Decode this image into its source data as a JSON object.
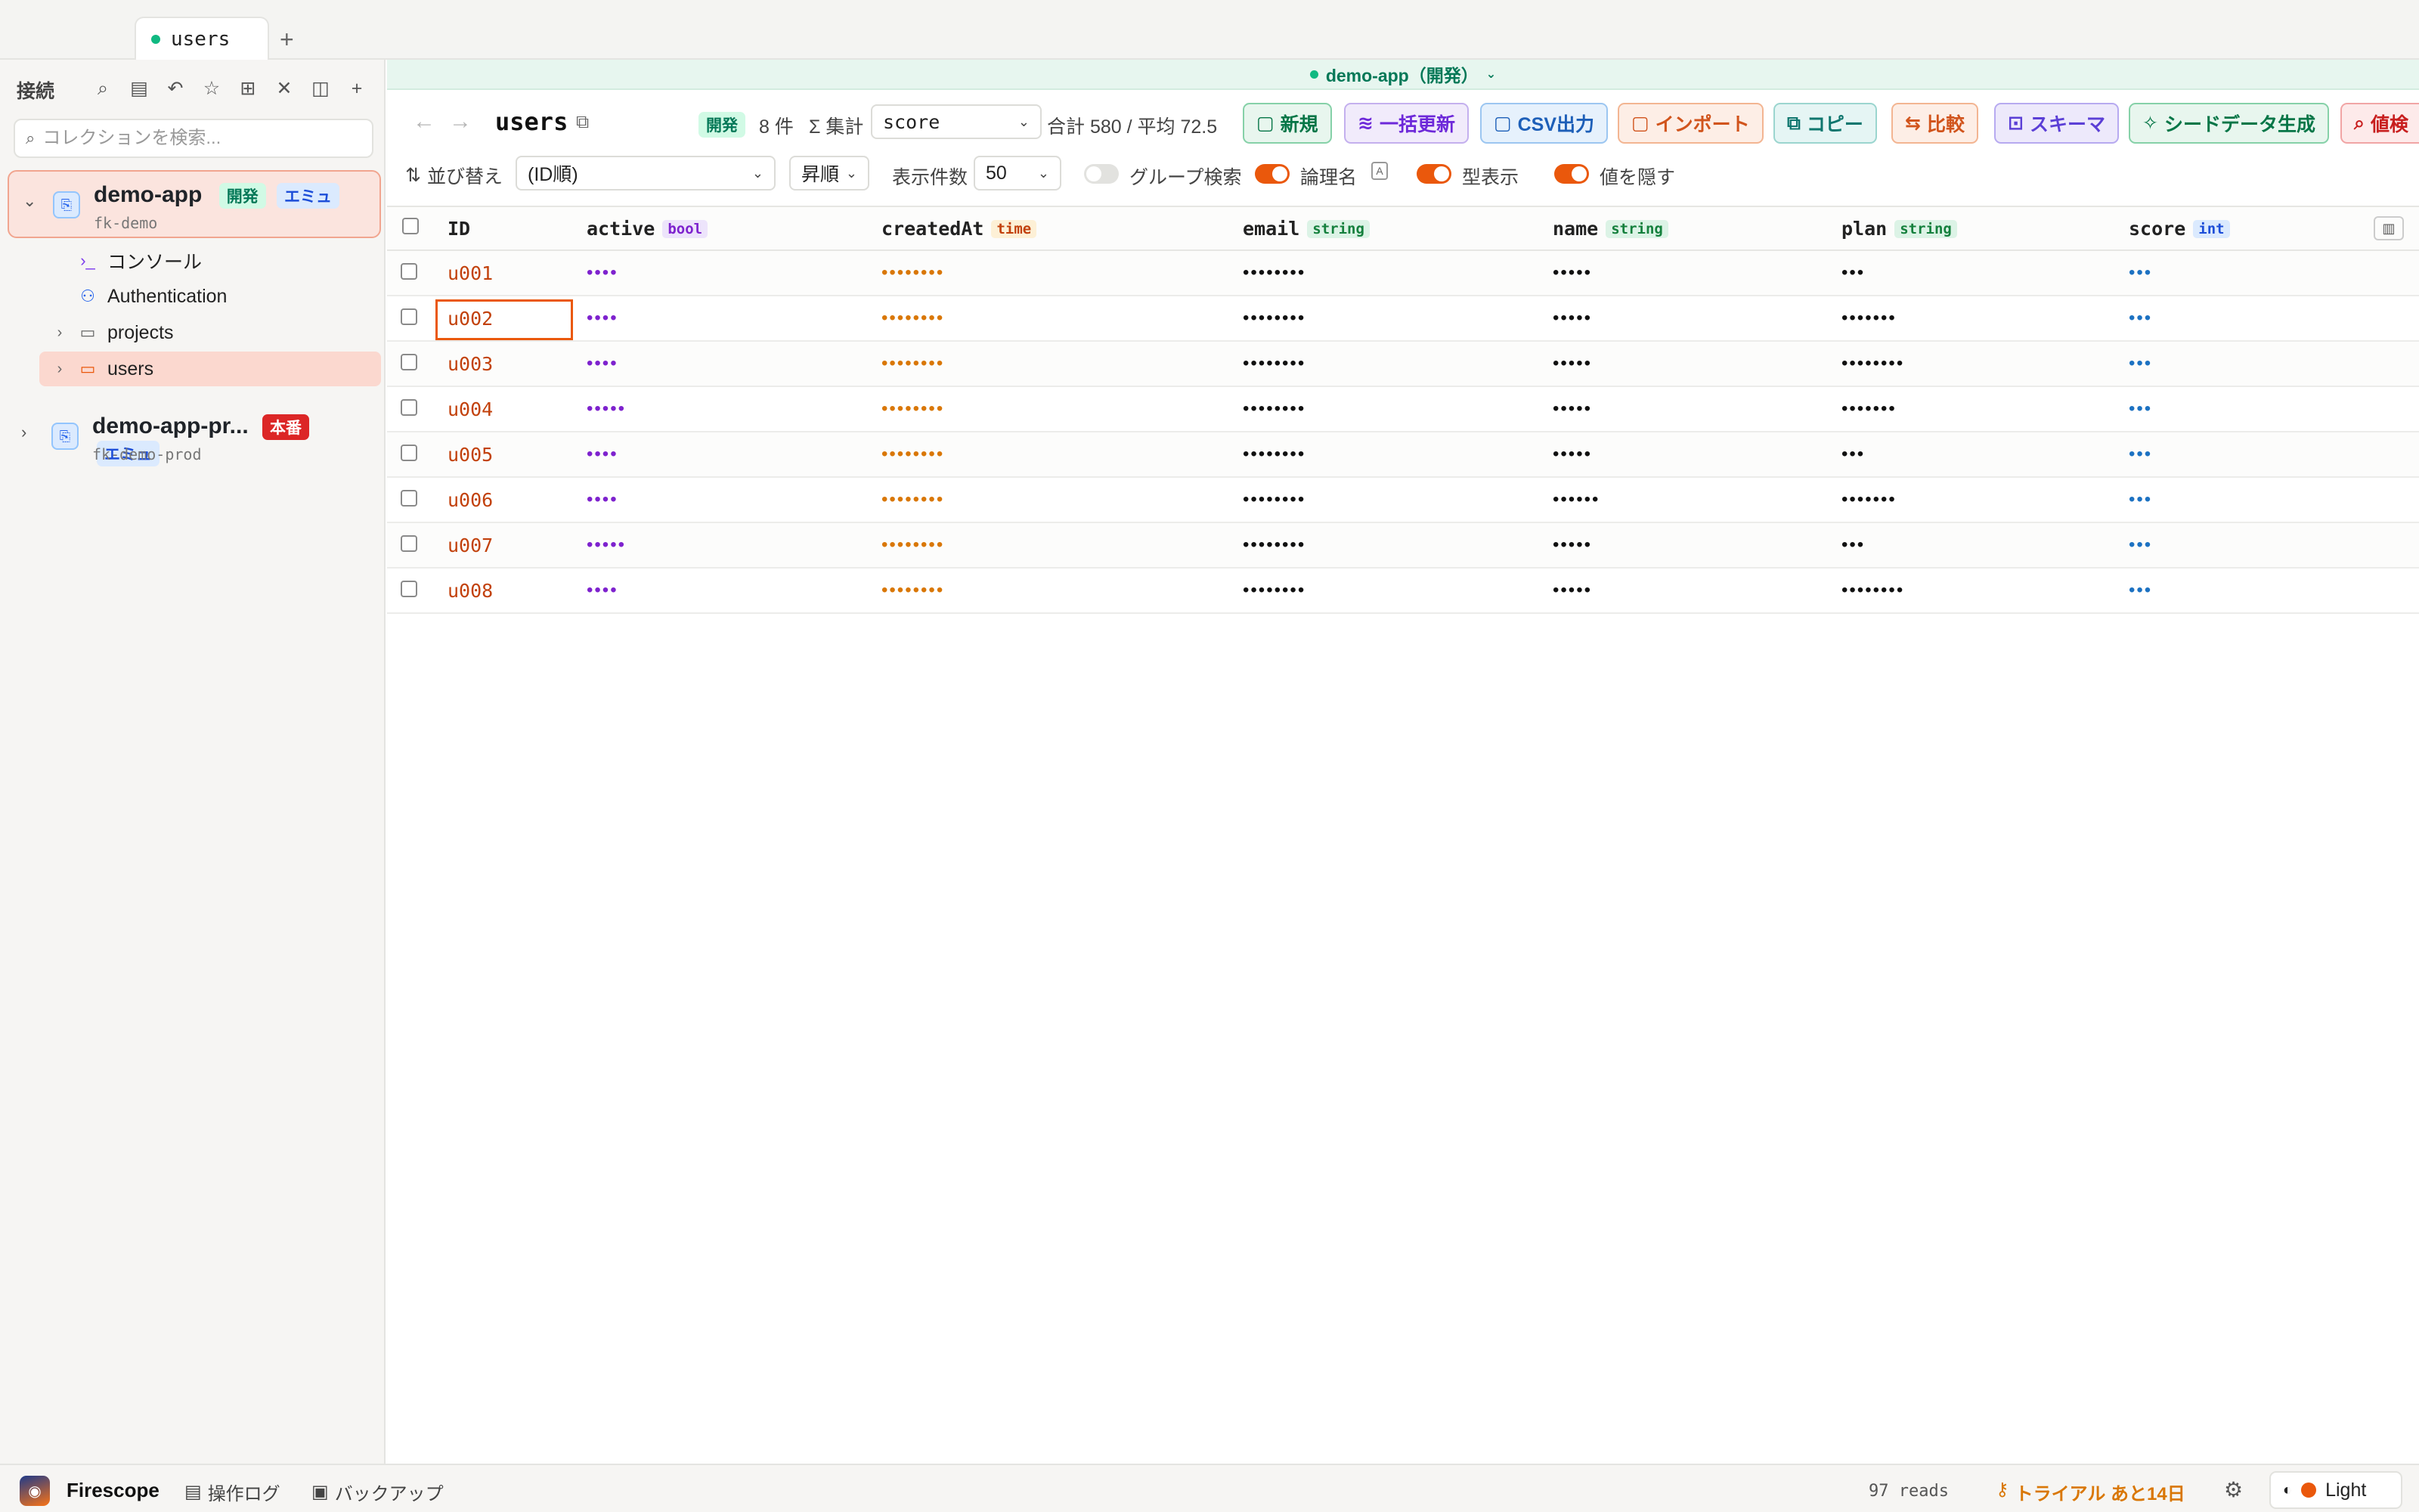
{
  "tab": {
    "label": "users",
    "add": "+"
  },
  "sidebar": {
    "heading": "接続",
    "search_placeholder": "コレクションを検索...",
    "connections": [
      {
        "name": "demo-app",
        "project": "fk-demo",
        "env_badge": "開発",
        "emu_badge": "エミュ",
        "expanded": true
      },
      {
        "name": "demo-app-pr...",
        "project": "fk-demo-prod",
        "env_badge": "本番",
        "emu_badge": "エミュ",
        "expanded": false
      }
    ],
    "tree": [
      {
        "label": "コンソール",
        "icon": "terminal-icon"
      },
      {
        "label": "Authentication",
        "icon": "users-icon"
      },
      {
        "label": "projects",
        "icon": "folder-icon"
      },
      {
        "label": "users",
        "icon": "folder-open-icon",
        "selected": true
      }
    ]
  },
  "env_bar": {
    "label": "demo-app（開発）"
  },
  "toolbar": {
    "collection": "users",
    "env_badge": "開発",
    "count": "8 件",
    "aggregate_label": "集計",
    "aggregate_field": "score",
    "aggregate_result": "合計 580 / 平均 72.5",
    "buttons": {
      "new": "新規",
      "bulk_update": "一括更新",
      "csv": "CSV出力",
      "import": "インポート",
      "copy": "コピー",
      "compare": "比較",
      "schema": "スキーマ",
      "seed": "シードデータ生成",
      "value_search": "値検"
    }
  },
  "filters": {
    "sort_label": "並び替え",
    "sort_value": "(ID順)",
    "order_value": "昇順",
    "page_size_label": "表示件数",
    "page_size_value": "50",
    "group_search": "グループ検索",
    "logical_name": "論理名",
    "type_display": "型表示",
    "hide_values": "値を隠す"
  },
  "table": {
    "columns": [
      {
        "name": "ID",
        "type": ""
      },
      {
        "name": "active",
        "type": "bool"
      },
      {
        "name": "createdAt",
        "type": "time"
      },
      {
        "name": "email",
        "type": "string"
      },
      {
        "name": "name",
        "type": "string"
      },
      {
        "name": "plan",
        "type": "string"
      },
      {
        "name": "score",
        "type": "int"
      }
    ],
    "rows": [
      {
        "id": "u001",
        "active": "••••",
        "createdAt": "••••••••",
        "email": "••••••••",
        "name": "•••••",
        "plan": "•••",
        "score": "•••"
      },
      {
        "id": "u002",
        "active": "••••",
        "createdAt": "••••••••",
        "email": "••••••••",
        "name": "•••••",
        "plan": "•••••••",
        "score": "•••"
      },
      {
        "id": "u003",
        "active": "••••",
        "createdAt": "••••••••",
        "email": "••••••••",
        "name": "•••••",
        "plan": "••••••••",
        "score": "•••"
      },
      {
        "id": "u004",
        "active": "•••••",
        "createdAt": "••••••••",
        "email": "••••••••",
        "name": "•••••",
        "plan": "•••••••",
        "score": "•••"
      },
      {
        "id": "u005",
        "active": "••••",
        "createdAt": "••••••••",
        "email": "••••••••",
        "name": "•••••",
        "plan": "•••",
        "score": "•••"
      },
      {
        "id": "u006",
        "active": "••••",
        "createdAt": "••••••••",
        "email": "••••••••",
        "name": "••••••",
        "plan": "•••••••",
        "score": "•••"
      },
      {
        "id": "u007",
        "active": "•••••",
        "createdAt": "••••••••",
        "email": "••••••••",
        "name": "•••••",
        "plan": "•••",
        "score": "•••"
      },
      {
        "id": "u008",
        "active": "••••",
        "createdAt": "••••••••",
        "email": "••••••••",
        "name": "•••••",
        "plan": "••••••••",
        "score": "•••"
      }
    ]
  },
  "statusbar": {
    "app_name": "Firescope",
    "op_log": "操作ログ",
    "backup": "バックアップ",
    "reads": "97 reads",
    "trial": "トライアル あと14日",
    "theme": "Light"
  },
  "colors": {
    "accent": "#ea580c",
    "dev": "#10b981",
    "prod": "#dc2626"
  }
}
